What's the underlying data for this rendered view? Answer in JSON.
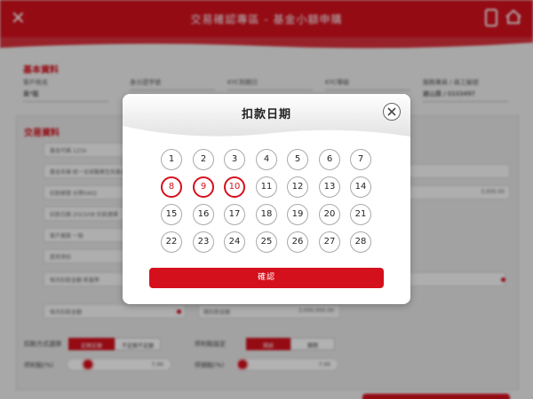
{
  "app": {
    "title": "交易確認專區 - 基金小額申購",
    "close_glyph": "✕",
    "section_basic": "基本資料",
    "section_trade": "交易資料",
    "info_cols": [
      {
        "key": "客戶姓名",
        "value": "黃*龍"
      },
      {
        "key": "身分證字號",
        "value": ""
      },
      {
        "key": "KYC到期日",
        "value": ""
      },
      {
        "key": "KYC等級",
        "value": ""
      },
      {
        "key": "服務專員 / 員工編號",
        "value": "謝山霖 / 0103497"
      }
    ],
    "form_rows": [
      "基金代碼 1234",
      "基金名稱 統一全球醫療生技基金",
      "扣款帳號 台幣0402",
      "扣款日期 2023/08 扣款選擇",
      "客戶風險 一般",
      "是否停扣",
      "每月扣款金額 新臺幣"
    ],
    "amount_text": "3,000.00",
    "extra_field": "每月扣款金額",
    "amount_box_label": "總扣款金額",
    "amount_box_value": "3,000,000.00",
    "toggle_label_1": "扣款方式選擇",
    "toggle_on_1": "定期定額",
    "toggle_off_1": "不定期不定額",
    "toggle_label_2": "停利點設定",
    "toggle_on_2": "開啟",
    "toggle_off_2": "關閉",
    "slider_label_1": "停利點(%)",
    "slider_value_1": "7.00",
    "slider_label_2": "停損點(%)",
    "slider_value_2": "7.00"
  },
  "dialog": {
    "title": "扣款日期",
    "confirm_label": "確認",
    "days": [
      "1",
      "2",
      "3",
      "4",
      "5",
      "6",
      "7",
      "8",
      "9",
      "10",
      "11",
      "12",
      "13",
      "14",
      "15",
      "16",
      "17",
      "18",
      "19",
      "20",
      "21",
      "22",
      "23",
      "24",
      "25",
      "26",
      "27",
      "28"
    ],
    "selected": [
      "8",
      "9",
      "10"
    ]
  },
  "colors": {
    "brand_red": "#d5101d",
    "circle_border": "#a9a9a9"
  }
}
